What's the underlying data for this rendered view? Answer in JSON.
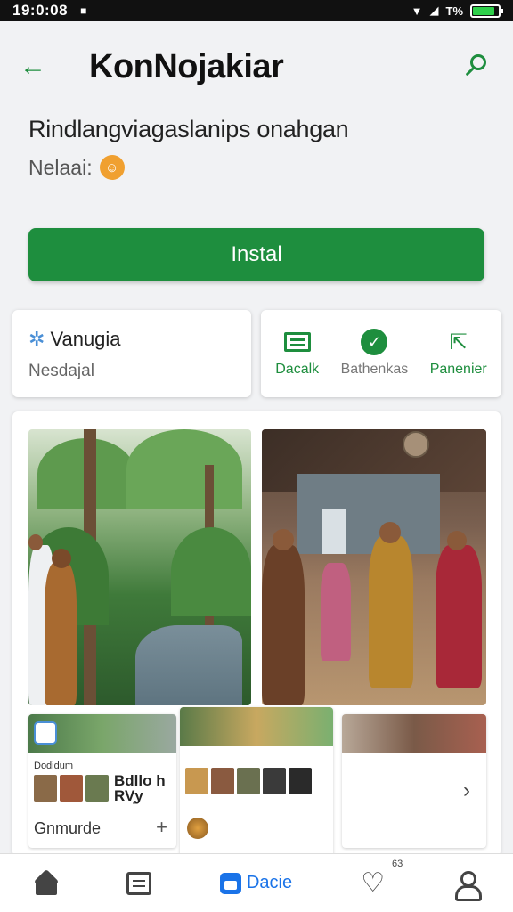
{
  "status_bar": {
    "time": "19:0:08",
    "notification_icon": "notification-icon",
    "signal_label": "T%",
    "battery_level": 0.85,
    "battery_color": "#2fd04b"
  },
  "app_bar": {
    "title": "KonNojakiar",
    "back_icon": "arrow-left-icon",
    "search_icon": "search-icon"
  },
  "app_info": {
    "subtitle": "Rindlangviagaslanips onahgan",
    "rating_label": "Nelaai:",
    "rating_badge": "☺"
  },
  "install_button": {
    "label": "Instal"
  },
  "info_card": {
    "name": "Vanugia",
    "developer": "Nesdajal"
  },
  "actions": [
    {
      "label": "Dacalk",
      "icon": "download-list-icon"
    },
    {
      "label": "Bathenkas",
      "icon": "check-circle-icon"
    },
    {
      "label": "Panenier",
      "icon": "share-icon"
    }
  ],
  "gallery": {
    "mini_cards": [
      {
        "caption": "Dodidum",
        "side_text": "Bdllo h\nRV̧y",
        "footer": "Gnmurde",
        "plus": "+"
      },
      {
        "caption": "",
        "side_text": "",
        "footer": "",
        "plus": ""
      },
      {
        "caption": "",
        "side_text": "",
        "footer": "",
        "chevron": "›"
      }
    ]
  },
  "bottom_nav": [
    {
      "id": "home",
      "icon": "home-icon",
      "label": ""
    },
    {
      "id": "list",
      "icon": "list-icon",
      "label": ""
    },
    {
      "id": "apps",
      "icon": "apps-icon",
      "label": "Dacie"
    },
    {
      "id": "likes",
      "icon": "heart-icon",
      "label": "",
      "count": "63"
    },
    {
      "id": "profile",
      "icon": "user-icon",
      "label": ""
    }
  ],
  "colors": {
    "primary_green": "#1e8e3e",
    "accent_blue": "#1a73e8",
    "background": "#f1f2f4"
  }
}
